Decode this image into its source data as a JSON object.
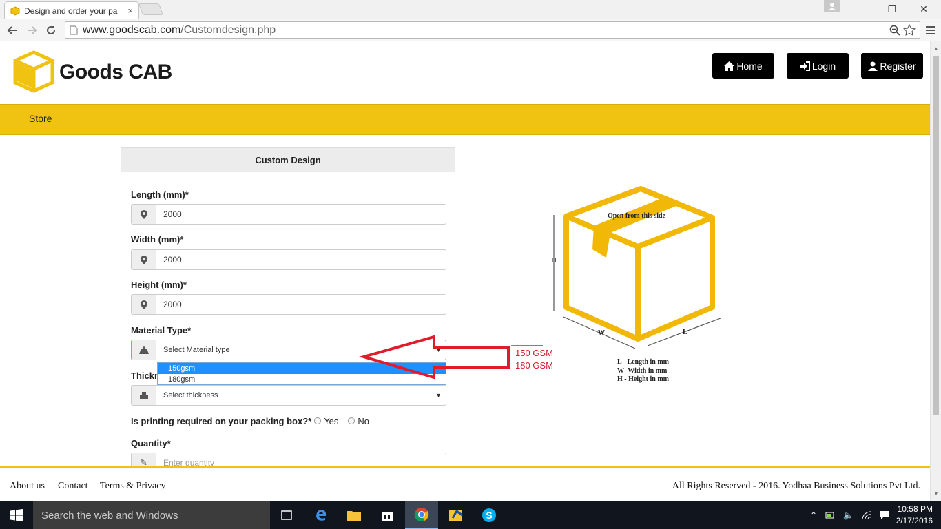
{
  "browser": {
    "tab_title": "Design and order your pa",
    "tab_close": "×",
    "url_host": "www.goodscab.com",
    "url_path": "/Customdesign.php",
    "min": "–",
    "max": "❐",
    "close": "✕"
  },
  "site": {
    "brand": "Goods CAB",
    "nav": {
      "home": "Home",
      "login": "Login",
      "register": "Register"
    },
    "menu_store": "Store",
    "colors": {
      "accent": "#f0c211",
      "button": "#000000"
    }
  },
  "form": {
    "heading": "Custom Design",
    "length_label": "Length (mm)*",
    "length_value": "2000",
    "width_label": "Width (mm)*",
    "width_value": "2000",
    "height_label": "Height (mm)*",
    "height_value": "2000",
    "material_label": "Material Type*",
    "material_value": "Select Material type",
    "material_options": [
      "150gsm",
      "180gsm"
    ],
    "thickness_label_partial": "Thickn",
    "thickness_value": "Select thickness",
    "printing_label": "Is printing required on your packing box?*",
    "printing_yes": "Yes",
    "printing_no": "No",
    "quantity_label": "Quantity*",
    "quantity_placeholder": "Enter quantity"
  },
  "annotation": {
    "line1": "150 GSM",
    "line2": "180 GSM",
    "color": "#d42030"
  },
  "diagram": {
    "top_text": "Open from this side",
    "h": "H",
    "w": "W",
    "l": "L",
    "legend_l": "L - Length in mm",
    "legend_w": "W- Width in mm",
    "legend_h": "H - Height in mm"
  },
  "footer": {
    "about": "About us",
    "contact": "Contact",
    "terms": "Terms & Privacy",
    "sep": "|",
    "copyright": "All Rights Reserved - 2016. Yodhaa Business Solutions Pvt Ltd."
  },
  "taskbar": {
    "search_placeholder": "Search the web and Windows",
    "time": "10:58 PM",
    "date": "2/17/2016"
  }
}
